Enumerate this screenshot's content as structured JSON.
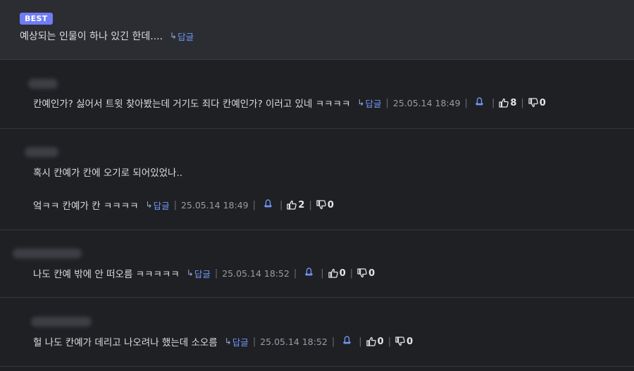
{
  "best": {
    "badge": "BEST",
    "text": "예상되는 인물이 하나 있긴 한데....",
    "reply": "답글"
  },
  "comments": [
    {
      "text": "칸예인가? 싫어서 트윗 찾아봤는데 거기도 죄다 칸예인가? 이러고 있네 ㅋㅋㅋㅋ",
      "reply": "답글",
      "date": "25.05.14 18:49",
      "likes": "8",
      "dislikes": "0"
    },
    {
      "title": "혹시 칸예가 칸에 오기로 되어있었나..",
      "text": "엌ㅋㅋ 칸예가 칸 ㅋㅋㅋㅋ",
      "reply": "답글",
      "date": "25.05.14 18:49",
      "likes": "2",
      "dislikes": "0"
    },
    {
      "text": "나도 칸예 밖에 안 떠오름 ㅋㅋㅋㅋㅋ",
      "reply": "답글",
      "date": "25.05.14 18:52",
      "likes": "0",
      "dislikes": "0"
    },
    {
      "text": "헐 나도 칸예가 데리고 나오려나 했는데 소오름",
      "reply": "답글",
      "date": "25.05.14 18:52",
      "likes": "0",
      "dislikes": "0"
    }
  ],
  "icons": {
    "reply": "reply-arrow-icon",
    "report": "bell-icon",
    "like": "thumbs-up-icon",
    "dislike": "thumbs-down-icon"
  },
  "colors": {
    "badge": "#6f7cf4",
    "link": "#6f94f0",
    "background": "#1f2024",
    "best_background": "#2b2d33"
  }
}
